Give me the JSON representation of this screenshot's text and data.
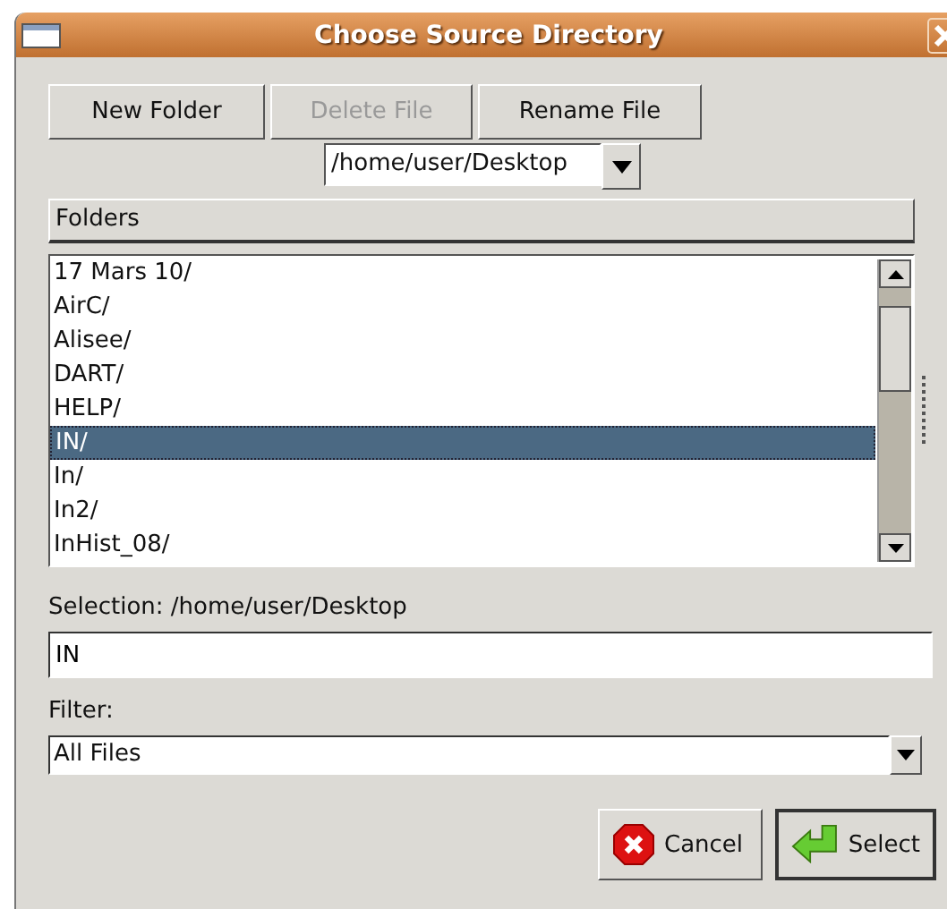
{
  "window": {
    "title": "Choose Source Directory"
  },
  "toolbar": [
    {
      "label": "New Folder",
      "disabled": false
    },
    {
      "label": "Delete File",
      "disabled": true
    },
    {
      "label": "Rename File",
      "disabled": false
    }
  ],
  "path_combo": {
    "value": "/home/user/Desktop"
  },
  "folders": {
    "header": "Folders",
    "items": [
      {
        "name": "17 Mars 10/",
        "selected": false
      },
      {
        "name": "AirC/",
        "selected": false
      },
      {
        "name": "Alisee/",
        "selected": false
      },
      {
        "name": "DART/",
        "selected": false
      },
      {
        "name": "HELP/",
        "selected": false
      },
      {
        "name": "IN/",
        "selected": true
      },
      {
        "name": "In/",
        "selected": false
      },
      {
        "name": "In2/",
        "selected": false
      },
      {
        "name": "InHist_08/",
        "selected": false
      }
    ]
  },
  "selection": {
    "label": "Selection:",
    "path": "/home/user/Desktop",
    "value": "IN"
  },
  "filter": {
    "label": "Filter:",
    "value": "All Files"
  },
  "buttons": [
    {
      "kind": "cancel",
      "label": "Cancel"
    },
    {
      "kind": "select",
      "label": "Select"
    }
  ]
}
